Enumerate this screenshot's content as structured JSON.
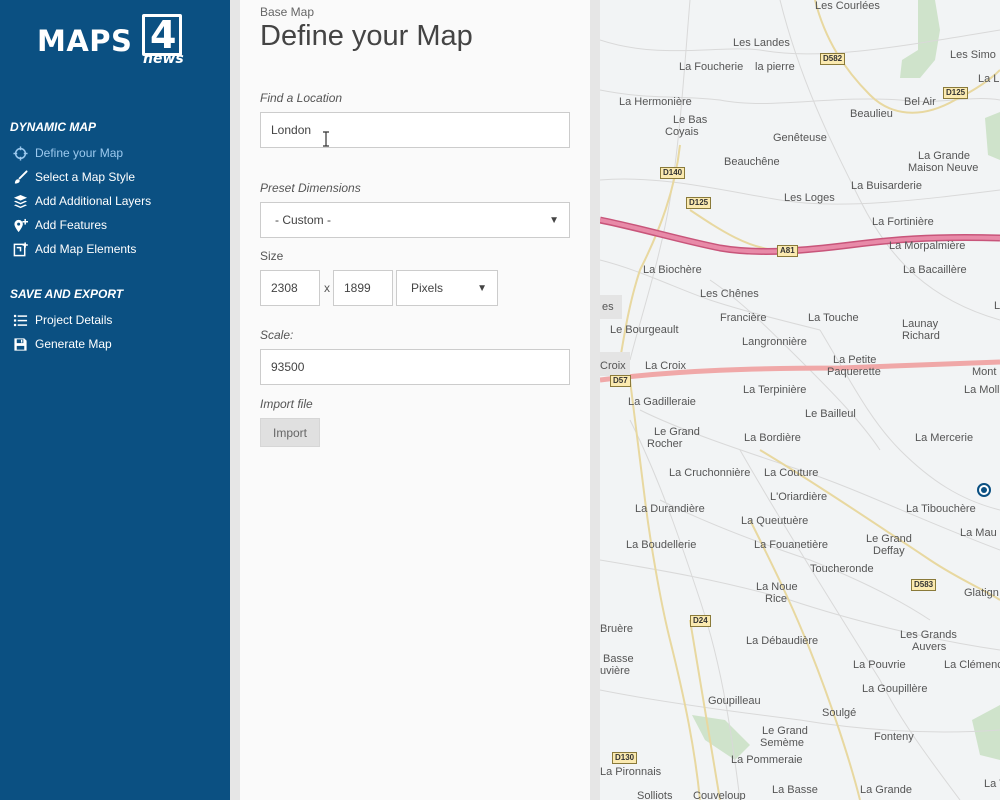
{
  "logo": {
    "main": "MAPS",
    "digit": "4",
    "sub": "news"
  },
  "sidebar": {
    "section1": "DYNAMIC MAP",
    "section2": "SAVE AND EXPORT",
    "items": [
      {
        "label": "Define your Map",
        "icon": "crosshair-icon",
        "active": true
      },
      {
        "label": "Select a Map Style",
        "icon": "brush-icon"
      },
      {
        "label": "Add Additional Layers",
        "icon": "layers-icon"
      },
      {
        "label": "Add Features",
        "icon": "features-icon"
      },
      {
        "label": "Add Map Elements",
        "icon": "map-elements-icon"
      },
      {
        "label": "Project Details",
        "icon": "list-icon"
      },
      {
        "label": "Generate Map",
        "icon": "save-icon"
      }
    ]
  },
  "panel": {
    "breadcrumb": "Base Map",
    "title": "Define your Map",
    "location_label": "Find a Location",
    "location_value": "London",
    "preset_label": "Preset Dimensions",
    "preset_value": "- Custom -",
    "size_label": "Size",
    "width_value": "2308",
    "times": "x",
    "height_value": "1899",
    "unit_value": "Pixels",
    "scale_label": "Scale:",
    "scale_value": "93500",
    "import_label": "Import file",
    "import_button": "Import"
  },
  "map": {
    "places": [
      "Les Courlées",
      "Les Landes",
      "Les Simo",
      "La Foucherie",
      "la pierre",
      "La L",
      "Bel Air",
      "La Hermonière",
      "Beaulieu",
      "Le Bas",
      "Coyais",
      "Genêteuse",
      "Beauchêne",
      "La Grande",
      "Maison Neuve",
      "La Buisarderie",
      "Les Loges",
      "La Fortinière",
      "La Morpalmière",
      "La Biochère",
      "La Bacaillère",
      "es",
      "Les Chênes",
      "Le Bourgeault",
      "Francière",
      "La Touche",
      "Launay",
      "Richard",
      "L",
      "Langronnière",
      "La Petite",
      "Paquerette",
      "Croix",
      "La Croix",
      "Mont",
      "La Gadilleraie",
      "La Terpinière",
      "La Mollièr",
      "Le Bailleul",
      "Le Grand",
      "Rocher",
      "La Bordière",
      "La Mercerie",
      "La Cruchonnière",
      "La Couture",
      "L'Oriardière",
      "La Durandière",
      "La Queutuère",
      "La Tibouchère",
      "Le Grand",
      "Deffay",
      "La Mau",
      "La Boudellerie",
      "La Fouanetière",
      "Toucheronde",
      "Glatign",
      "La Noue",
      "Rice",
      "Bruère",
      "La Débaudière",
      "Les Grands",
      "Auvers",
      "Basse",
      "uvière",
      "La Pouvrie",
      "La Clémencié",
      "La Goupillère",
      "Goupilleau",
      "Le Grand",
      "Semème",
      "Soulgé",
      "Fonteny",
      "La Pommeraie",
      "La Pironnais",
      "Solliots",
      "Couveloup",
      "La Basse",
      "La Grande",
      "La V"
    ],
    "roads": [
      "D582",
      "D125",
      "D140",
      "D125",
      "A81",
      "D57",
      "D583",
      "D24",
      "D130"
    ]
  },
  "colors": {
    "sidebar": "#0b5082",
    "active": "#9cc9ee",
    "motorway": "#e37a9a",
    "primary": "#f0a8a8"
  }
}
